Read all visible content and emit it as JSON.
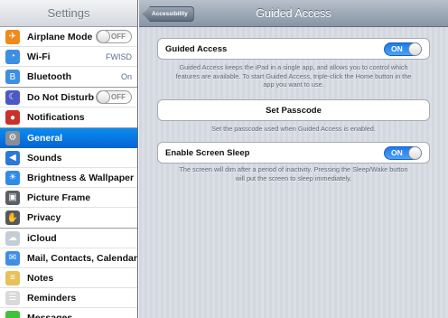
{
  "sidebar": {
    "title": "Settings",
    "groups": [
      {
        "items": [
          {
            "label": "Airplane Mode",
            "icon": "airplane-icon",
            "color": "#f08a1c",
            "toggle": "OFF"
          },
          {
            "label": "Wi-Fi",
            "icon": "wifi-icon",
            "color": "#3d8fe2",
            "value": "FWISD"
          },
          {
            "label": "Bluetooth",
            "icon": "bluetooth-icon",
            "color": "#3d8fe2",
            "value": "On"
          }
        ]
      },
      {
        "items": [
          {
            "label": "Do Not Disturb",
            "icon": "moon-icon",
            "color": "#4c59c2",
            "toggle": "OFF"
          },
          {
            "label": "Notifications",
            "icon": "notifications-icon",
            "color": "#c9322b"
          }
        ]
      },
      {
        "items": [
          {
            "label": "General",
            "icon": "gear-icon",
            "color": "#8a8f96",
            "selected": true
          },
          {
            "label": "Sounds",
            "icon": "speaker-icon",
            "color": "#2c78d8"
          },
          {
            "label": "Brightness & Wallpaper",
            "icon": "brightness-icon",
            "color": "#2f8be8"
          },
          {
            "label": "Picture Frame",
            "icon": "picture-frame-icon",
            "color": "#5b5f66"
          },
          {
            "label": "Privacy",
            "icon": "hand-icon",
            "color": "#55585e"
          }
        ]
      },
      {
        "items": [
          {
            "label": "iCloud",
            "icon": "cloud-icon",
            "color": "#c4ccd6"
          },
          {
            "label": "Mail, Contacts, Calendars",
            "icon": "mail-icon",
            "color": "#3f8ee3"
          },
          {
            "label": "Notes",
            "icon": "notes-icon",
            "color": "#e8c15a"
          },
          {
            "label": "Reminders",
            "icon": "reminders-icon",
            "color": "#d9d9d9"
          },
          {
            "label": "Messages",
            "icon": "messages-icon",
            "color": "#3fc23a"
          }
        ]
      }
    ]
  },
  "navbar": {
    "back_label": "Accessibility",
    "title": "Guided Access"
  },
  "detail": {
    "guided_access": {
      "label": "Guided Access",
      "toggle": "ON"
    },
    "guided_access_note": "Guided Access keeps the iPad in a single app, and allows you to control which features are available. To start Guided Access, triple-click the Home button in the app you want to use.",
    "set_passcode": {
      "label": "Set Passcode"
    },
    "passcode_note": "Set the passcode used when Guided Access is enabled.",
    "screen_sleep": {
      "label": "Enable Screen Sleep",
      "toggle": "ON"
    },
    "screen_sleep_note": "The screen will dim after a period of inactivity. Pressing the Sleep/Wake button will put the screen to sleep immediately."
  }
}
